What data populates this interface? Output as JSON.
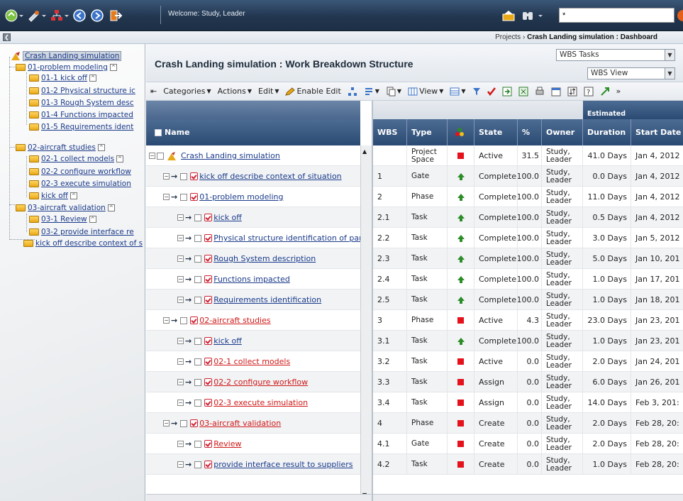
{
  "top": {
    "welcome": "Welcome: Study, Leader",
    "search_value": "*"
  },
  "crumbs": {
    "first": "Projects",
    "sep": "›",
    "current": "Crash Landing simulation : Dashboard"
  },
  "tree": {
    "root": "Crash Landing simulation",
    "n1": "01-problem modeling",
    "n1a": "01-1 kick off",
    "n1b": "01-2 Physical structure ic",
    "n1c": "01-3 Rough System desc",
    "n1d": "01-4 Functions impacted",
    "n1e": "01-5 Requirements ident",
    "n2": "02-aircraft studies",
    "n2a": "02-1 collect models",
    "n2b": "02-2 configure workflow",
    "n2c": "02-3 execute simulation",
    "n2d": "kick off",
    "n3": "03-aircraft validation",
    "n3a": "03-1 Review",
    "n3b": "03-2 provide interface re",
    "n4": "kick off describe context of s"
  },
  "wbs": {
    "title": "Crash Landing simulation : Work Breakdown Structure",
    "select1": "WBS Tasks",
    "select2": "WBS View",
    "toolbar": {
      "categories": "Categories",
      "actions": "Actions",
      "edit": "Edit",
      "enable_edit": "Enable Edit",
      "view": "View",
      "more": "»"
    },
    "band_label": "Estimated",
    "headers": {
      "name": "Name",
      "wbs": "WBS",
      "type": "Type",
      "state": "State",
      "pct": "%",
      "owner": "Owner",
      "duration": "Duration",
      "start": "Start Date"
    },
    "rows": [
      {
        "name": "Crash Landing simulation",
        "wbs": "",
        "type": "Project Space",
        "state": "Active",
        "pct": "31.5",
        "owner": "Study, Leader",
        "duration": "41.0 Days",
        "start": "Jan 4, 2012",
        "status": "red",
        "level": 0,
        "color": "#1a3a8a"
      },
      {
        "name": "kick off describe context of situation",
        "wbs": "1",
        "type": "Gate",
        "state": "Complete",
        "pct": "100.0",
        "owner": "Study, Leader",
        "duration": "0.0 Days",
        "start": "Jan 4, 2012",
        "status": "green",
        "level": 1,
        "color": "#1a3a8a"
      },
      {
        "name": "01-problem modeling",
        "wbs": "2",
        "type": "Phase",
        "state": "Complete",
        "pct": "100.0",
        "owner": "Study, Leader",
        "duration": "11.0 Days",
        "start": "Jan 4, 2012",
        "status": "green",
        "level": 1,
        "color": "#1a3a8a"
      },
      {
        "name": "kick off",
        "wbs": "2.1",
        "type": "Task",
        "state": "Complete",
        "pct": "100.0",
        "owner": "Study, Leader",
        "duration": "0.5 Days",
        "start": "Jan 4, 2012",
        "status": "green",
        "level": 2,
        "color": "#1a3a8a"
      },
      {
        "name": "Physical structure identification of par",
        "wbs": "2.2",
        "type": "Task",
        "state": "Complete",
        "pct": "100.0",
        "owner": "Study, Leader",
        "duration": "3.0 Days",
        "start": "Jan 5, 2012",
        "status": "green",
        "level": 2,
        "color": "#1a3a8a"
      },
      {
        "name": "Rough System description",
        "wbs": "2.3",
        "type": "Task",
        "state": "Complete",
        "pct": "100.0",
        "owner": "Study, Leader",
        "duration": "5.0 Days",
        "start": "Jan 10, 201",
        "status": "green",
        "level": 2,
        "color": "#1a3a8a"
      },
      {
        "name": "Functions impacted",
        "wbs": "2.4",
        "type": "Task",
        "state": "Complete",
        "pct": "100.0",
        "owner": "Study, Leader",
        "duration": "1.0 Days",
        "start": "Jan 17, 201",
        "status": "green",
        "level": 2,
        "color": "#1a3a8a"
      },
      {
        "name": "Requirements identification",
        "wbs": "2.5",
        "type": "Task",
        "state": "Complete",
        "pct": "100.0",
        "owner": "Study, Leader",
        "duration": "1.0 Days",
        "start": "Jan 18, 201",
        "status": "green",
        "level": 2,
        "color": "#1a3a8a"
      },
      {
        "name": "02-aircraft studies",
        "wbs": "3",
        "type": "Phase",
        "state": "Active",
        "pct": "4.3",
        "owner": "Study, Leader",
        "duration": "23.0 Days",
        "start": "Jan 23, 201",
        "status": "red",
        "level": 1,
        "color": "#d01818"
      },
      {
        "name": "kick off",
        "wbs": "3.1",
        "type": "Task",
        "state": "Complete",
        "pct": "100.0",
        "owner": "Study, Leader",
        "duration": "1.0 Days",
        "start": "Jan 23, 201",
        "status": "green",
        "level": 2,
        "color": "#1a3a8a"
      },
      {
        "name": "02-1 collect models",
        "wbs": "3.2",
        "type": "Task",
        "state": "Active",
        "pct": "0.0",
        "owner": "Study, Leader",
        "duration": "2.0 Days",
        "start": "Jan 24, 201",
        "status": "red",
        "level": 2,
        "color": "#d01818"
      },
      {
        "name": "02-2 configure workflow",
        "wbs": "3.3",
        "type": "Task",
        "state": "Assign",
        "pct": "0.0",
        "owner": "Study, Leader",
        "duration": "6.0 Days",
        "start": "Jan 26, 201",
        "status": "red",
        "level": 2,
        "color": "#d01818"
      },
      {
        "name": "02-3 execute simulation",
        "wbs": "3.4",
        "type": "Task",
        "state": "Assign",
        "pct": "0.0",
        "owner": "Study, Leader",
        "duration": "14.0 Days",
        "start": "Feb 3, 201:",
        "status": "red",
        "level": 2,
        "color": "#d01818"
      },
      {
        "name": "03-aircraft validation",
        "wbs": "4",
        "type": "Phase",
        "state": "Create",
        "pct": "0.0",
        "owner": "Study, Leader",
        "duration": "2.0 Days",
        "start": "Feb 28, 20:",
        "status": "red",
        "level": 1,
        "color": "#d01818"
      },
      {
        "name": "Review",
        "wbs": "4.1",
        "type": "Gate",
        "state": "Create",
        "pct": "0.0",
        "owner": "Study, Leader",
        "duration": "2.0 Days",
        "start": "Feb 28, 20:",
        "status": "red",
        "level": 2,
        "color": "#d01818"
      },
      {
        "name": "provide interface result to suppliers",
        "wbs": "4.2",
        "type": "Task",
        "state": "Create",
        "pct": "0.0",
        "owner": "Study, Leader",
        "duration": "1.0 Days",
        "start": "Feb 28, 20:",
        "status": "red",
        "level": 2,
        "color": "#1a3a8a"
      }
    ]
  }
}
